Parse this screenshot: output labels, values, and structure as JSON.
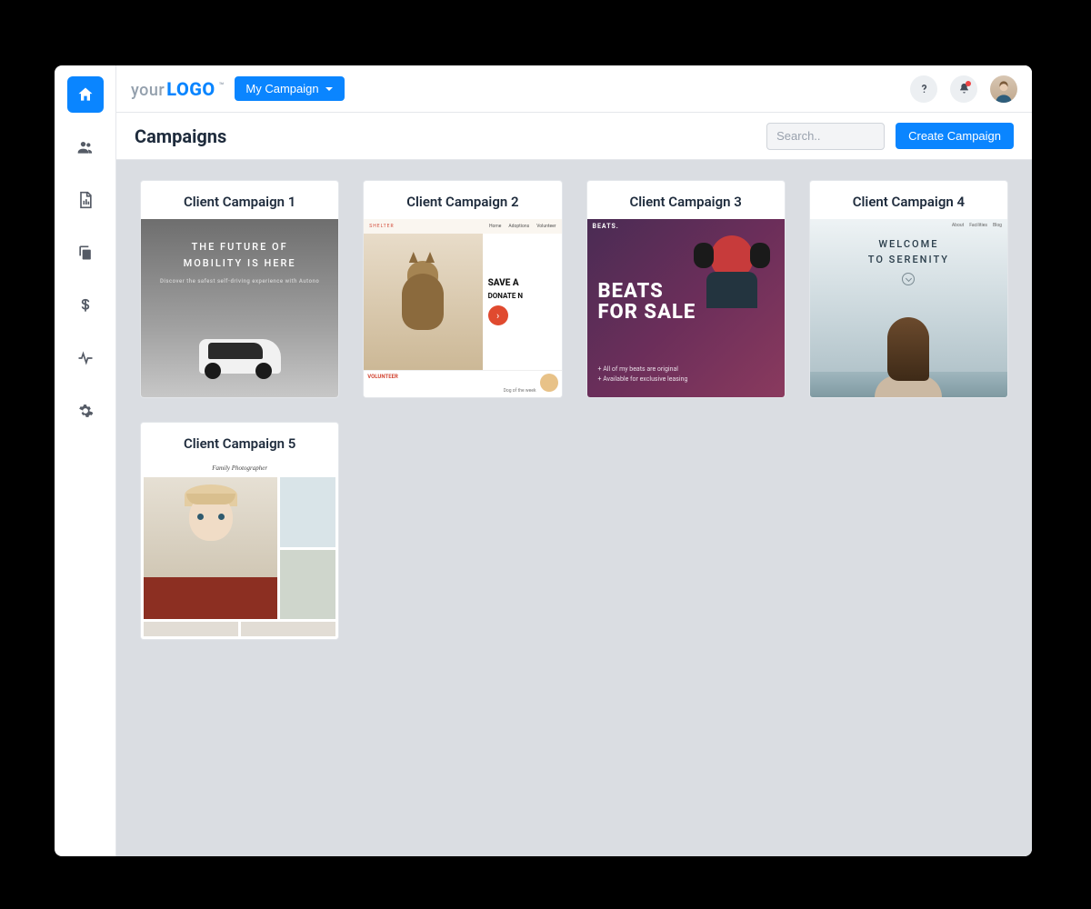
{
  "brand": {
    "prefix": "your",
    "main": "LOGO",
    "tm": "™"
  },
  "topbar": {
    "dropdown_label": "My Campaign"
  },
  "page": {
    "title": "Campaigns",
    "search_placeholder": "Search..",
    "create_button": "Create Campaign"
  },
  "campaigns": [
    {
      "title": "Client Campaign 1",
      "thumb": {
        "headline_1": "THE FUTURE OF",
        "headline_2": "MOBILITY IS HERE",
        "sub": "Discover the safest self-driving experience with Autono"
      }
    },
    {
      "title": "Client Campaign 2",
      "thumb": {
        "nav_brand": "SHELTER",
        "nav_items": [
          "Home",
          "Adoptions",
          "Volunteer"
        ],
        "headline": "SAVE A",
        "sub": "DONATE N",
        "footer_label": "VOLUNTEER",
        "dog_label": "Dog of the week"
      }
    },
    {
      "title": "Client Campaign 3",
      "thumb": {
        "tag": "BEATS.",
        "headline_1": "BEATS",
        "headline_2": "FOR SALE",
        "bullets": [
          "All of my beats are original",
          "Available for exclusive leasing"
        ]
      }
    },
    {
      "title": "Client Campaign 4",
      "thumb": {
        "nav_items": [
          "About",
          "Facilities",
          "Blog"
        ],
        "headline_1": "WELCOME",
        "headline_2": "TO SERENITY"
      }
    },
    {
      "title": "Client Campaign 5",
      "thumb": {
        "header": "Family Photographer"
      }
    }
  ]
}
